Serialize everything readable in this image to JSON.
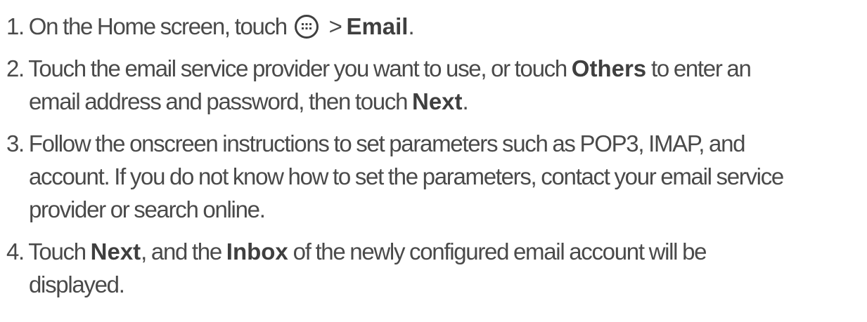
{
  "steps": [
    {
      "number": "1.",
      "lines": [
        {
          "pre": "On the Home screen, touch ",
          "icon": "apps-grid-icon",
          "mid": " > ",
          "bold": "Email",
          "post": "."
        }
      ]
    },
    {
      "number": "2.",
      "line1": {
        "pre": "Touch the email service provider you want to use, or touch ",
        "bold": "Others",
        "post": " to enter an"
      },
      "line2": {
        "pre": "email address and password, then touch ",
        "bold": "Next",
        "post": "."
      }
    },
    {
      "number": "3.",
      "line1": "Follow the onscreen instructions to set parameters such as POP3, IMAP, and",
      "line2": "account. If you do not know how to set the parameters, contact your email service",
      "line3": "provider or search online."
    },
    {
      "number": "4.",
      "line1": {
        "pre": "Touch ",
        "bold1": "Next",
        "mid": ", and the ",
        "bold2": "Inbox",
        "post": " of the newly configured email account will be"
      },
      "line2": "displayed."
    }
  ]
}
